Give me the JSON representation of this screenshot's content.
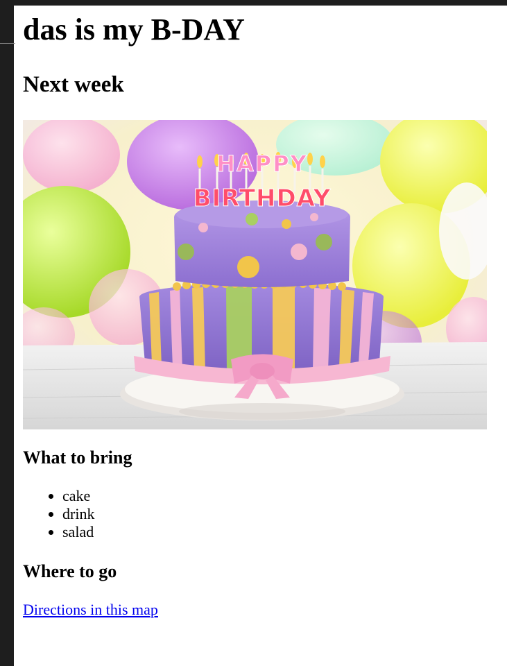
{
  "page": {
    "title": "das is my B-DAY",
    "subtitle": "Next week"
  },
  "hero_image": {
    "alt": "Birthday cake with HAPPY BIRTHDAY candles in front of colorful balloons",
    "candle_line_1": "HAPPY",
    "candle_line_2": "BIRTHDAY"
  },
  "bring_section": {
    "heading": "What to bring",
    "items": [
      "cake",
      "drink",
      "salad"
    ]
  },
  "where_section": {
    "heading": "Where to go",
    "link_text": "Directions in this map"
  },
  "colors": {
    "link": "#0000ee",
    "frame": "#1e1e1e",
    "background": "#ffffff"
  }
}
